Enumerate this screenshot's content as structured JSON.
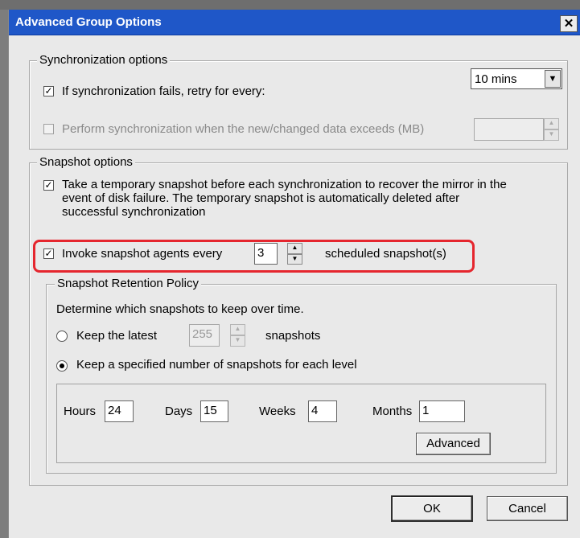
{
  "window": {
    "title": "Advanced Group Options",
    "close_label": "✕"
  },
  "sync": {
    "legend": "Synchronization options",
    "retry": {
      "label": "If synchronization fails, retry for every:",
      "checked": true,
      "value": "10 mins"
    },
    "threshold": {
      "label": "Perform synchronization when the new/changed data exceeds (MB)",
      "checked": false,
      "value": ""
    }
  },
  "snapshot": {
    "legend": "Snapshot options",
    "temp": {
      "label_line1": "Take a temporary snapshot before each synchronization to recover the mirror in the",
      "label_line2": "event of disk failure. The temporary snapshot is automatically deleted after",
      "label_line3": "successful synchronization",
      "checked": true
    },
    "invoke": {
      "label": "Invoke snapshot agents every",
      "value": "3",
      "suffix": "scheduled snapshot(s)",
      "checked": true
    }
  },
  "retention": {
    "legend": "Snapshot Retention Policy",
    "description": "Determine which snapshots to keep over time.",
    "keep_latest": {
      "label": "Keep the latest",
      "value": "255",
      "suffix": "snapshots",
      "selected": false
    },
    "keep_level": {
      "label": "Keep a specified number of snapshots for each level",
      "selected": true
    },
    "levels": {
      "hours_label": "Hours",
      "hours": "24",
      "days_label": "Days",
      "days": "15",
      "weeks_label": "Weeks",
      "weeks": "4",
      "months_label": "Months",
      "months": "1"
    },
    "advanced_label": "Advanced"
  },
  "footer": {
    "ok_label": "OK",
    "cancel_label": "Cancel"
  }
}
